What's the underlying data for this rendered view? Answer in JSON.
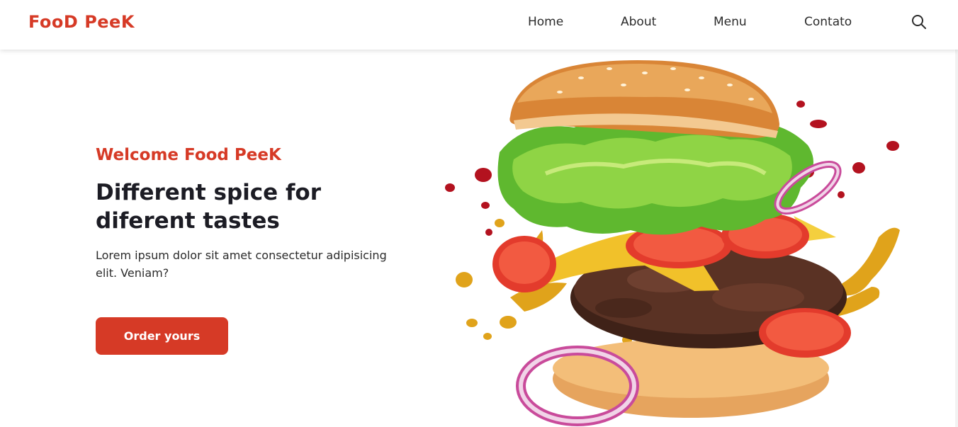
{
  "header": {
    "logo": {
      "part1": "Foo",
      "part2": "D ",
      "part3": "Pee",
      "part4": "K"
    },
    "nav": [
      "Home",
      "About",
      "Menu",
      "Contato"
    ],
    "search_icon": "search-icon"
  },
  "hero": {
    "subtitle": "Welcome Food PeeK",
    "title": "Different spice for diferent tastes",
    "text": "Lorem ipsum dolor sit amet consectetur adipisicing elit. Veniam?",
    "button_label": "Order yours",
    "image": "burger-illustration"
  },
  "colors": {
    "accent": "#d63a26",
    "heading": "#1c1c24",
    "text": "#2b2b2b",
    "background": "#ffffff"
  }
}
